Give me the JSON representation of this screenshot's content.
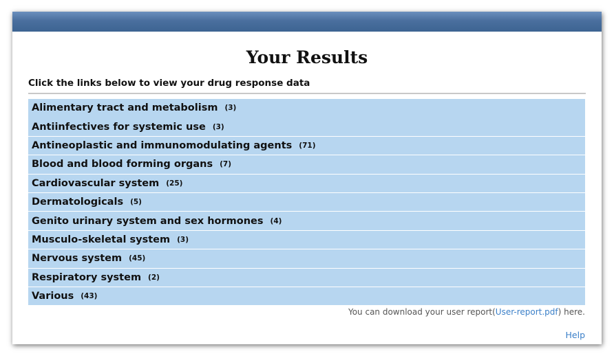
{
  "page": {
    "title": "Your Results",
    "instruction": "Click the links below to view your drug response data"
  },
  "categories": [
    {
      "name": "Alimentary tract and metabolism",
      "count": "(3)"
    },
    {
      "name": "Antiinfectives for systemic use",
      "count": "(3)"
    },
    {
      "name": "Antineoplastic and immunomodulating agents",
      "count": "(71)"
    },
    {
      "name": "Blood and blood forming organs",
      "count": "(7)"
    },
    {
      "name": "Cardiovascular system",
      "count": "(25)"
    },
    {
      "name": "Dermatologicals",
      "count": "(5)"
    },
    {
      "name": "Genito urinary system and sex hormones",
      "count": "(4)"
    },
    {
      "name": "Musculo-skeletal system",
      "count": "(3)"
    },
    {
      "name": "Nervous system",
      "count": "(45)"
    },
    {
      "name": "Respiratory system",
      "count": "(2)"
    },
    {
      "name": "Various",
      "count": "(43)"
    }
  ],
  "download": {
    "prefix": "You can download your user report(",
    "link": "User-report.pdf",
    "suffix": ") here."
  },
  "help": {
    "label": "Help"
  },
  "colors": {
    "header_bar": "#4a6f9e",
    "row_background": "#b7d6f0",
    "link": "#3a7fc8"
  }
}
